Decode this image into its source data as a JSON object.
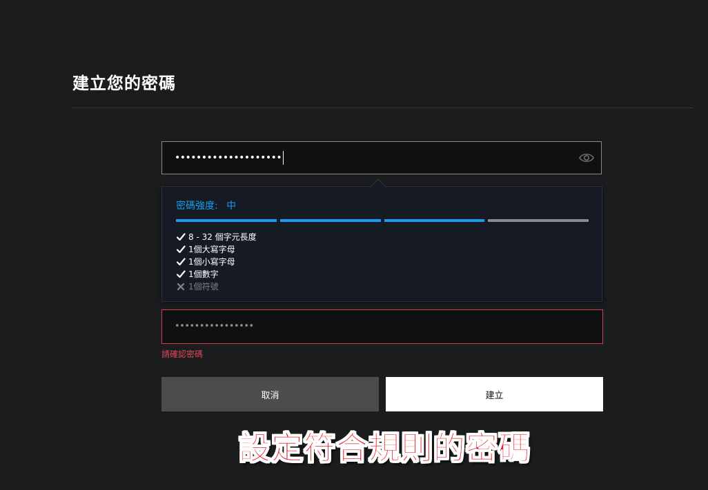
{
  "page": {
    "title": "建立您的密碼"
  },
  "password_field": {
    "value": "••••••••••••••••••••",
    "icon": "eye-icon"
  },
  "strength_popover": {
    "label": "密碼強度:",
    "level": "中",
    "level_fraction": 0.75,
    "segments_filled": 3,
    "segments_total": 4,
    "fill_color": "#1a9bec",
    "empty_color": "#8a8b8e",
    "rules": [
      {
        "text": "8 - 32 個字元長度",
        "passed": true
      },
      {
        "text": "1個大寫字母",
        "passed": true
      },
      {
        "text": "1個小寫字母",
        "passed": true
      },
      {
        "text": "1個數字",
        "passed": true
      },
      {
        "text": "1個符號",
        "passed": false
      }
    ]
  },
  "confirm_field": {
    "value": "••••••••••••••••",
    "error": "請確認密碼",
    "error_color": "#e0485a"
  },
  "buttons": {
    "cancel": "取消",
    "create": "建立"
  },
  "annotation": {
    "text": "設定符合規則的密碼",
    "color": "#ee1c25"
  }
}
